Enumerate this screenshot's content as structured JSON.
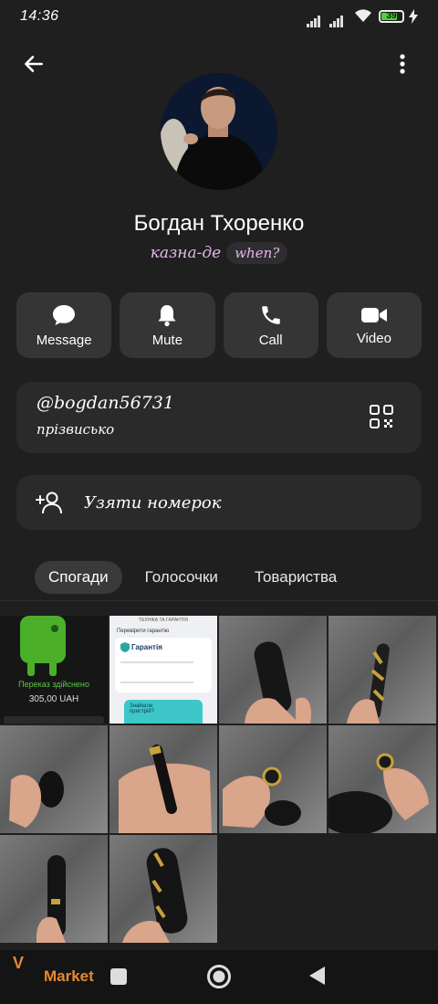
{
  "status_bar": {
    "time": "14:36",
    "battery": "39"
  },
  "profile": {
    "name": "Богдан Тхоренко",
    "status_text": "казна-де",
    "status_chip": "when?"
  },
  "actions": [
    {
      "label": "Message",
      "icon": "message-icon"
    },
    {
      "label": "Mute",
      "icon": "bell-icon"
    },
    {
      "label": "Call",
      "icon": "phone-icon"
    },
    {
      "label": "Video",
      "icon": "video-icon"
    }
  ],
  "info": {
    "username": "@bogdan56731",
    "username_label": "прізвисько"
  },
  "add_contact": {
    "label": "Узяти номерок"
  },
  "tabs": [
    "Спогади",
    "Голосочки",
    "Товариства"
  ],
  "media": {
    "tile1": {
      "text1": "Переказ здійснено",
      "text2": "305,00 UAH"
    },
    "tile2": {
      "header": "ТЕХНІКА ТА ГАРАНТІЯ",
      "line1": "Перевірити гарантію",
      "title": "Гарантія",
      "button": "Знайшли пристрій?"
    }
  },
  "watermark": {
    "letter": "V",
    "text": "Market"
  },
  "colors": {
    "background": "#1f1f1f",
    "card": "#2a2a2a",
    "accent_status": "#e8b6ef",
    "button": "#353535"
  }
}
